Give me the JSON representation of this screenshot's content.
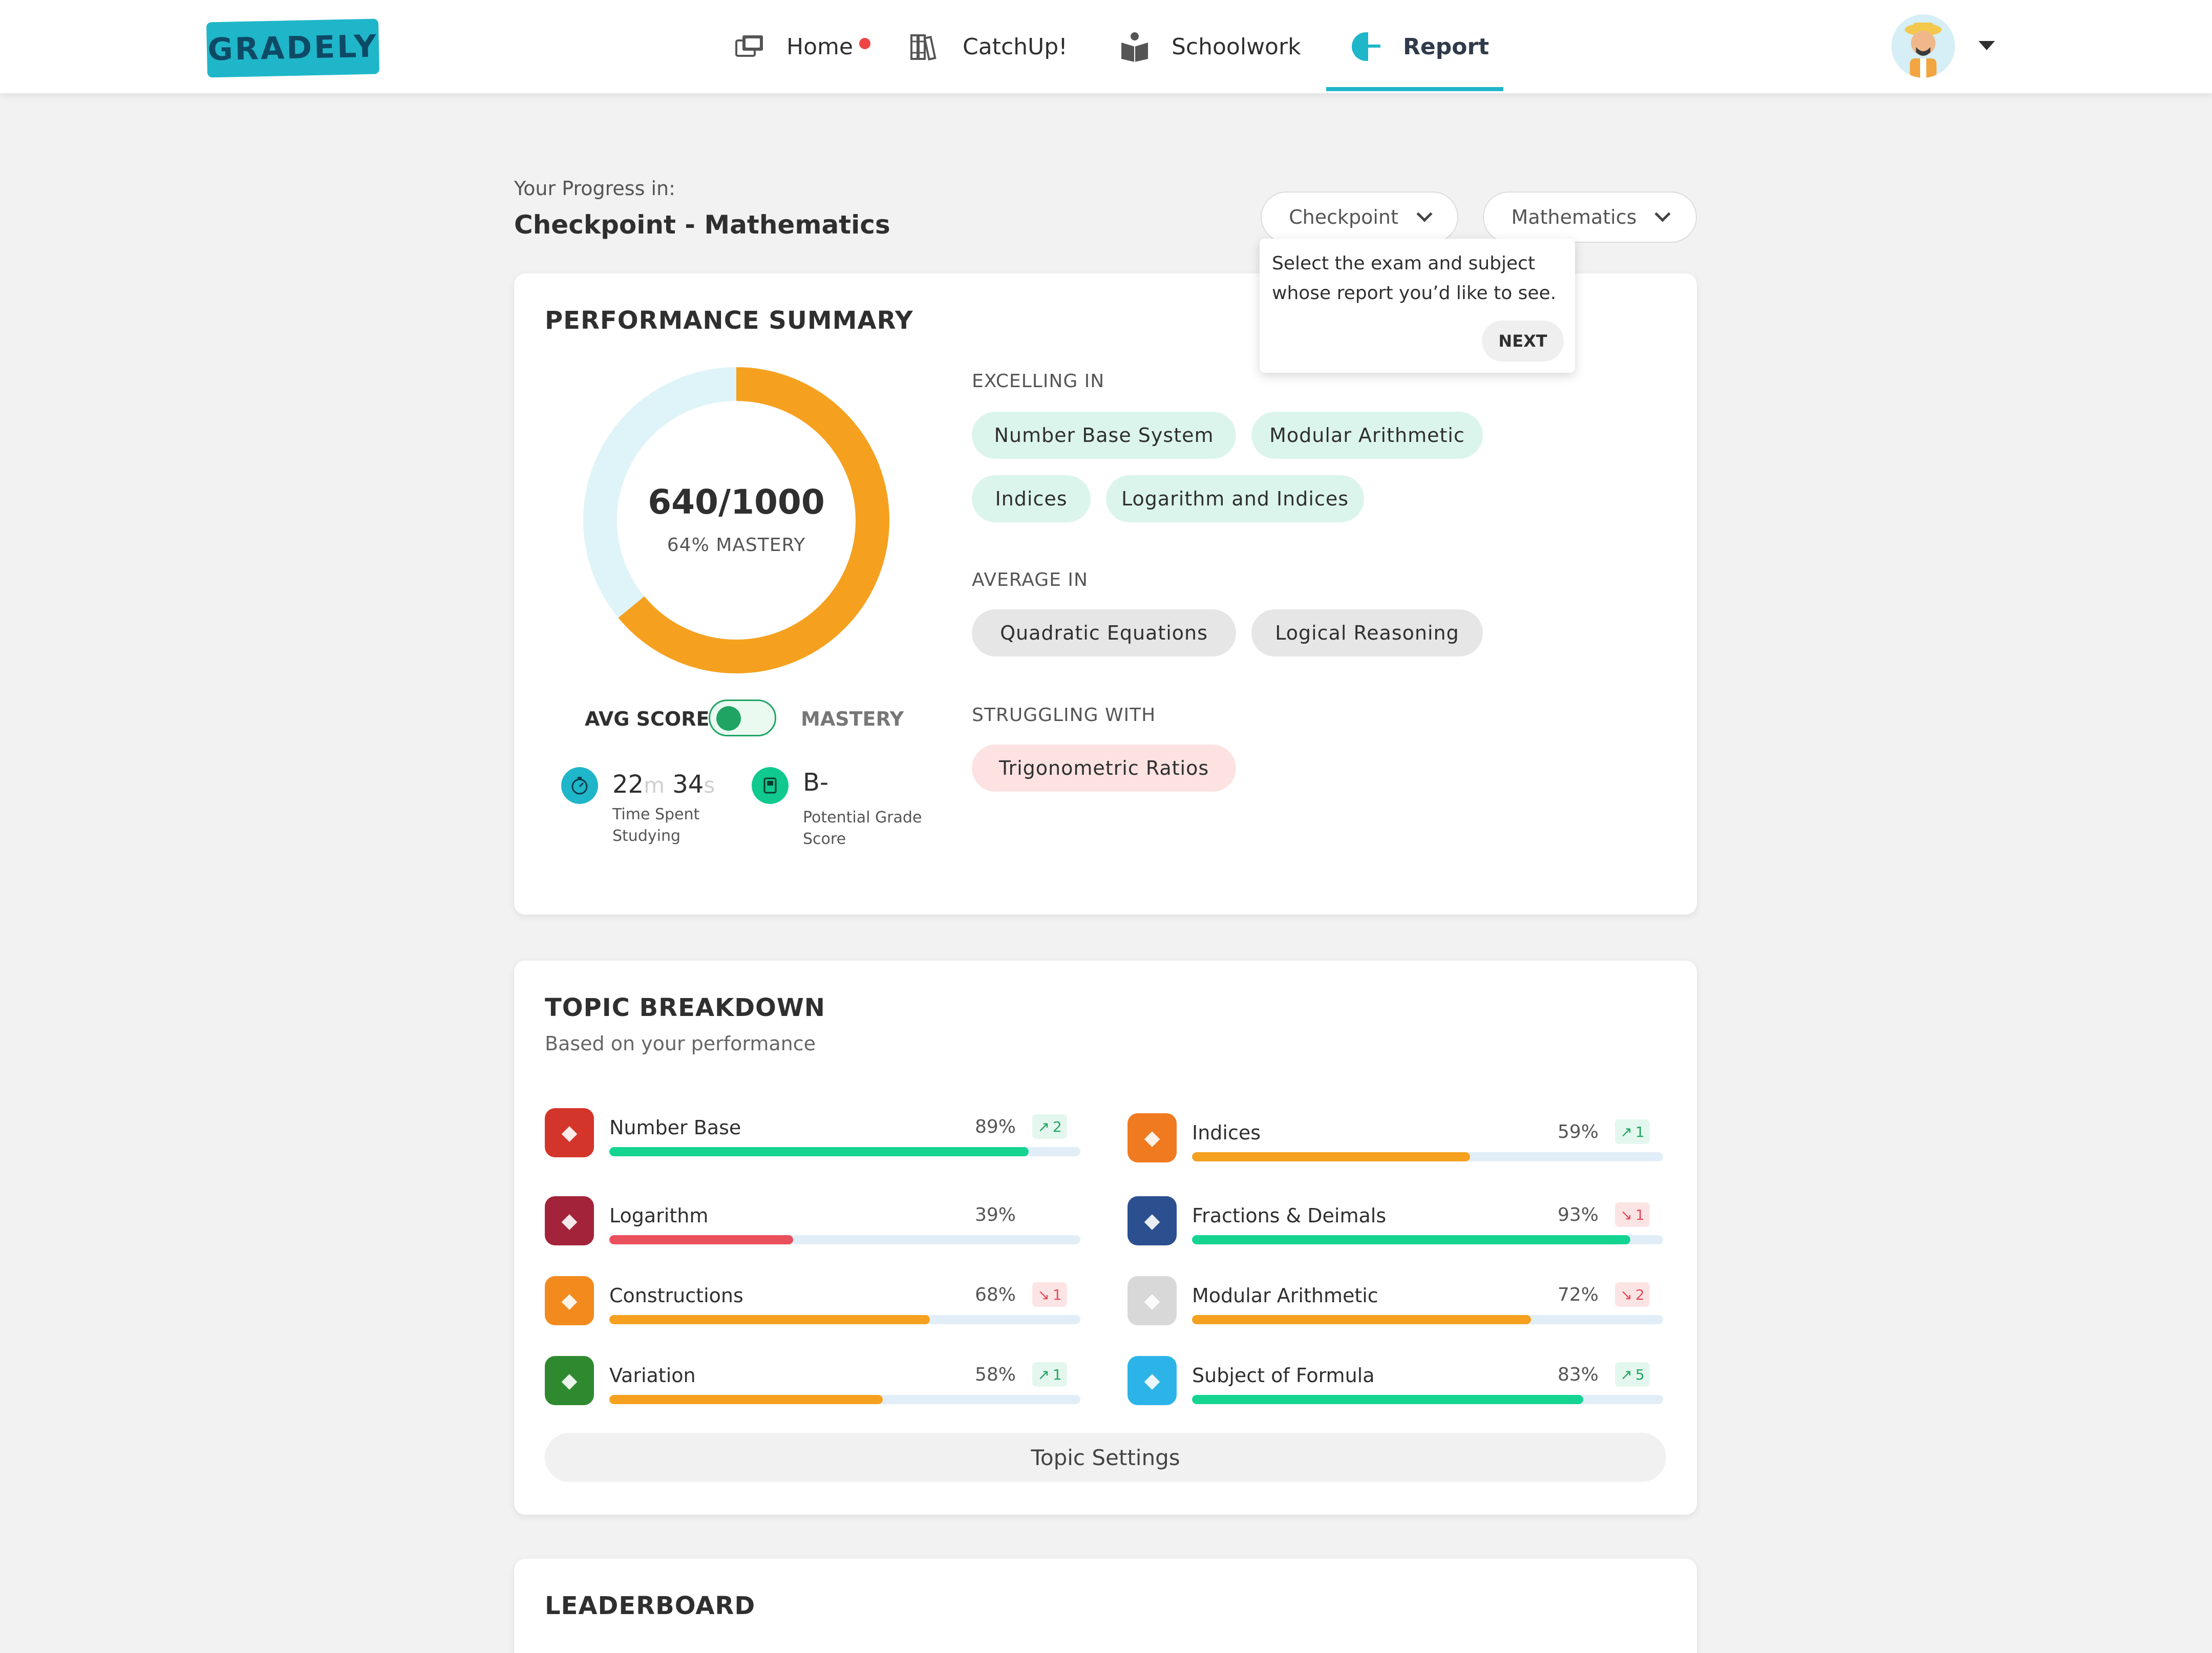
{
  "nav": {
    "logo": "GRADELY",
    "items": [
      {
        "label": "Home",
        "icon": "home-cards-icon"
      },
      {
        "label": "CatchUp!",
        "icon": "books-icon"
      },
      {
        "label": "Schoolwork",
        "icon": "reading-icon"
      },
      {
        "label": "Report",
        "icon": "pie-chart-icon",
        "active": true
      }
    ],
    "home_notification": true
  },
  "header": {
    "progress_label": "Your Progress in:",
    "title": "Checkpoint - Mathematics",
    "exam_select": "Checkpoint",
    "subject_select": "Mathematics"
  },
  "tooltip": {
    "text": "Select the exam and subject whose report you’d like to see.",
    "next_label": "NEXT"
  },
  "summary": {
    "title": "PERFORMANCE SUMMARY",
    "score": "640/1000",
    "mastery": "64% MASTERY",
    "mastery_fraction": 0.64,
    "toggle_left": "AVG SCORE",
    "toggle_right": "MASTERY",
    "time_minutes": "22",
    "time_minutes_unit": "m",
    "time_seconds": "34",
    "time_seconds_unit": "s",
    "time_caption": "Time Spent Studying",
    "grade": "B-",
    "grade_caption": "Potential Grade Score",
    "excelling_label": "EXCELLING IN",
    "excelling": [
      "Number Base System",
      "Modular Arithmetic",
      "Indices",
      "Logarithm and Indices"
    ],
    "average_label": "AVERAGE IN",
    "average": [
      "Quadratic Equations",
      "Logical Reasoning"
    ],
    "struggling_label": "STRUGGLING WITH",
    "struggling": [
      "Trigonometric Ratios"
    ]
  },
  "topics": {
    "title": "TOPIC BREAKDOWN",
    "subtitle": "Based on your performance",
    "settings_label": "Topic Settings",
    "items": [
      {
        "name": "Number Base",
        "pct": "89%",
        "value": 0.89,
        "trend": "up",
        "change": "2",
        "color": "#15d492",
        "icon_color": "#d4352a"
      },
      {
        "name": "Indices",
        "pct": "59%",
        "value": 0.59,
        "trend": "up",
        "change": "1",
        "color": "#f5a11f",
        "icon_color": "#f07a1f"
      },
      {
        "name": "Logarithm",
        "pct": "39%",
        "value": 0.39,
        "trend": "none",
        "change": "",
        "color": "#ea4f5c",
        "icon_color": "#a3243a"
      },
      {
        "name": "Fractions & Deimals",
        "pct": "93%",
        "value": 0.93,
        "trend": "down",
        "change": "1",
        "color": "#15d492",
        "icon_color": "#2b4f8f"
      },
      {
        "name": "Constructions",
        "pct": "68%",
        "value": 0.68,
        "trend": "down",
        "change": "1",
        "color": "#f5a11f",
        "icon_color": "#f28a1e"
      },
      {
        "name": "Modular Arithmetic",
        "pct": "72%",
        "value": 0.72,
        "trend": "down",
        "change": "2",
        "color": "#f5a11f",
        "icon_color": "#d8d8d8"
      },
      {
        "name": "Variation",
        "pct": "58%",
        "value": 0.58,
        "trend": "up",
        "change": "1",
        "color": "#f5a11f",
        "icon_color": "#2f8a2f"
      },
      {
        "name": "Subject of Formula",
        "pct": "83%",
        "value": 0.83,
        "trend": "up",
        "change": "5",
        "color": "#15d492",
        "icon_color": "#2cb4e8"
      }
    ]
  },
  "leaderboard": {
    "title": "LEADERBOARD"
  },
  "colors": {
    "accent": "#1fb6c9",
    "donut_progress": "#f5a11f",
    "donut_track": "#dff4f8"
  }
}
